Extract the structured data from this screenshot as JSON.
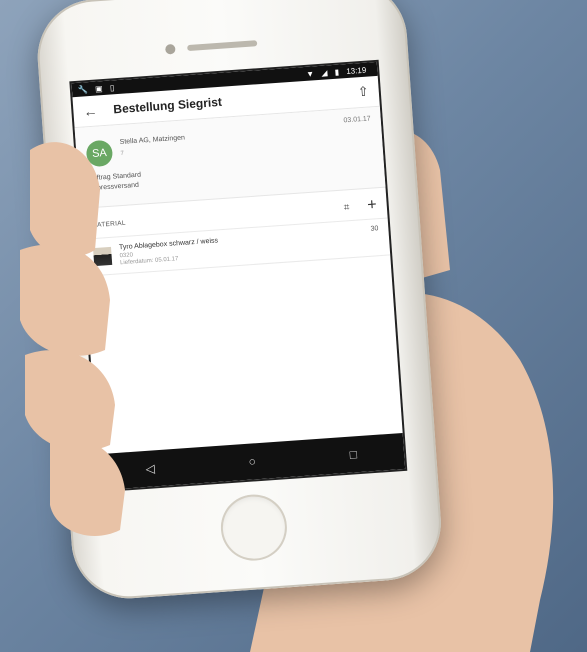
{
  "status_bar": {
    "time": "13:19",
    "left_icons": [
      "wrench-icon",
      "image-icon",
      "sim-icon"
    ],
    "right_icons": [
      "wifi-icon",
      "signal-icon",
      "battery-icon"
    ]
  },
  "app_bar": {
    "title": "Bestellung Siegrist",
    "back_icon": "arrow-left-icon",
    "action_icon": "upload-icon"
  },
  "customer": {
    "avatar_initials": "SA",
    "name": "Stella AG, Matzingen",
    "number": "7",
    "date": "03.01.17",
    "order_type": "Auftrag Standard",
    "shipping": "Expressversand",
    "avatar_color": "#6aa864"
  },
  "material": {
    "header": "MATERIAL",
    "items": [
      {
        "name": "Tyro Ablagebox schwarz / weiss",
        "code": "0320",
        "delivery_date": "Lieferdatum: 05.01.17",
        "quantity": "30"
      }
    ]
  },
  "nav_bar": {
    "back": "◁",
    "home": "○",
    "recents": "□"
  }
}
